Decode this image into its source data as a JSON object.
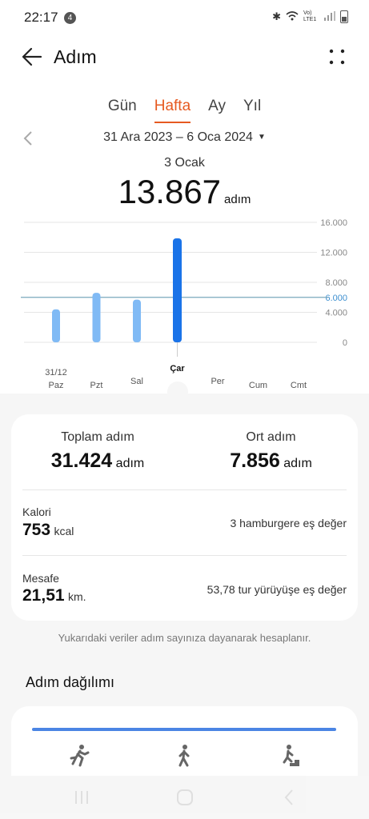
{
  "status": {
    "time": "22:17",
    "notification_count": "4",
    "network": "Vo) LTE1"
  },
  "header": {
    "title": "Adım"
  },
  "tabs": [
    {
      "label": "Gün",
      "active": false
    },
    {
      "label": "Hafta",
      "active": true
    },
    {
      "label": "Ay",
      "active": false
    },
    {
      "label": "Yıl",
      "active": false
    }
  ],
  "range": {
    "label": "31 Ara 2023 – 6 Oca 2024"
  },
  "selected": {
    "date": "3 Ocak",
    "value": "13.867",
    "unit": "adım"
  },
  "chart_data": {
    "type": "bar",
    "categories": [
      "Paz",
      "Pzt",
      "Sal",
      "Çar",
      "Per",
      "Cum",
      "Cmt"
    ],
    "date_label": "31/12",
    "values": [
      4400,
      6600,
      5700,
      13867,
      0,
      0,
      0
    ],
    "selected_index": 3,
    "ylim": [
      0,
      16000
    ],
    "y_ticks": [
      "16.000",
      "12.000",
      "8.000",
      "6.000",
      "4.000",
      "0"
    ],
    "y_tick_values": [
      16000,
      12000,
      8000,
      6000,
      4000,
      0
    ],
    "goal_value": 6000,
    "goal_label": "6.000",
    "colors": {
      "bar": "#80baf5",
      "selected_bar": "#1a73e8",
      "goal_line": "#7aa8bd",
      "goal_text": "#3d8fd0",
      "grid": "#e6e6e6"
    }
  },
  "summary": {
    "total_label": "Toplam adım",
    "total_value": "31.424",
    "total_unit": "adım",
    "avg_label": "Ort adım",
    "avg_value": "7.856",
    "avg_unit": "adım"
  },
  "calories": {
    "label": "Kalori",
    "value": "753",
    "unit": "kcal",
    "equivalent": "3 hamburgere eş değer"
  },
  "distance": {
    "label": "Mesafe",
    "value": "21,51",
    "unit": "km.",
    "equivalent": "53,78 tur yürüyüşe eş değer"
  },
  "note": "Yukarıdaki veriler adım sayınıza dayanarak hesaplanır.",
  "distribution": {
    "title": "Adım dağılımı",
    "icons": [
      "running-icon",
      "walking-icon",
      "stairs-icon"
    ]
  }
}
